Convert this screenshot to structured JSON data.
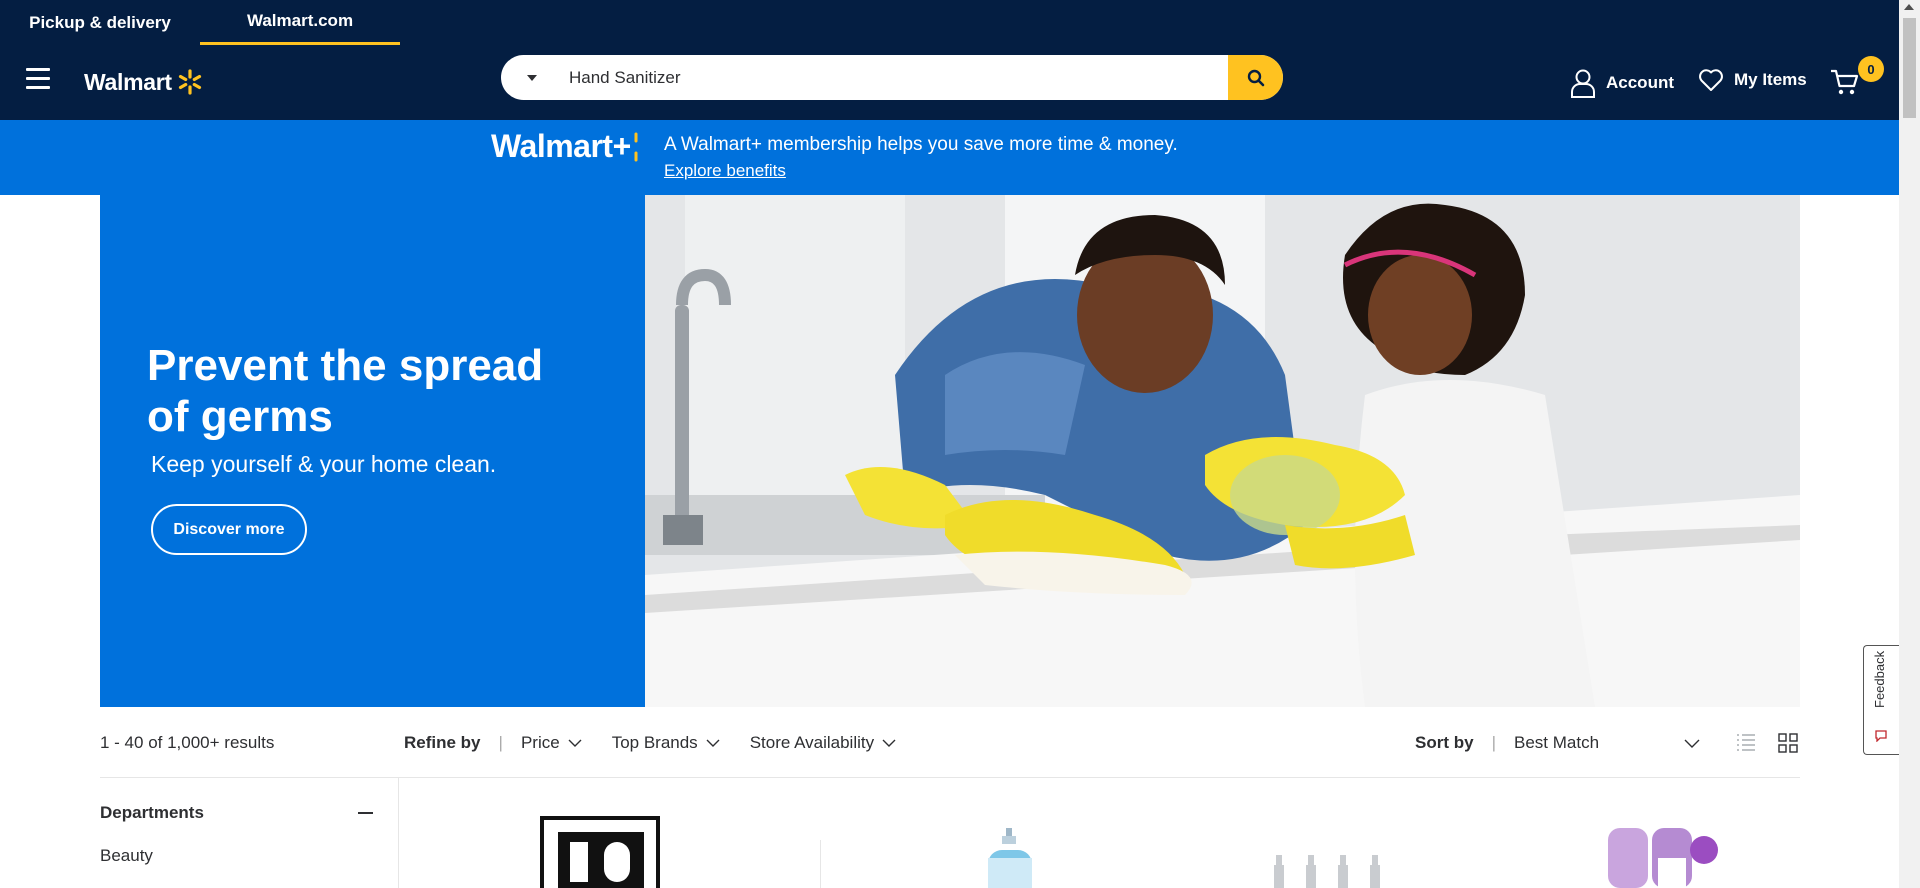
{
  "header": {
    "tabs": [
      {
        "label": "Pickup & delivery"
      },
      {
        "label": "Walmart.com"
      }
    ],
    "logo_text": "Walmart",
    "search": {
      "value": "Hand Sanitizer",
      "placeholder": "Search Walmart.com"
    },
    "account_label": "Account",
    "my_items_label": "My Items",
    "cart_count": "0"
  },
  "plus_banner": {
    "logo_text": "Walmart+",
    "message": "A Walmart+ membership helps you save more time & money.",
    "link": "Explore benefits"
  },
  "hero": {
    "title": "Prevent the spread of germs",
    "subtitle": "Keep yourself & your home clean.",
    "button": "Discover more"
  },
  "results": {
    "count": "1 - 40 of 1,000+ results",
    "refine_label": "Refine by",
    "filters": [
      "Price",
      "Top Brands",
      "Store Availability"
    ],
    "sort_label": "Sort by",
    "sort_value": "Best Match"
  },
  "sidebar": {
    "departments_title": "Departments",
    "items": [
      "Beauty"
    ]
  },
  "feedback_label": "Feedback",
  "colors": {
    "navy": "#041e42",
    "blue": "#0071dc",
    "yellow": "#ffc220"
  }
}
